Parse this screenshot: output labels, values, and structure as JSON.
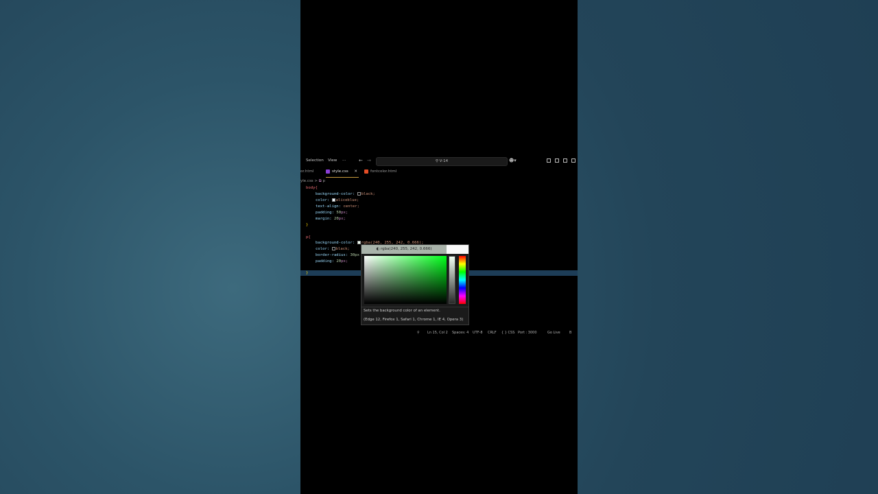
{
  "menu": {
    "selection": "Selection",
    "view": "View",
    "more": "···"
  },
  "search": {
    "text": "V-14"
  },
  "icons": {
    "back": "arrow-left-icon",
    "forward": "arrow-right-icon",
    "search": "search-icon",
    "copilot": "copilot-icon",
    "layouts": [
      "layout-icon",
      "sidebar-left-icon",
      "panel-icon",
      "sidebar-right-icon"
    ]
  },
  "tabs": [
    {
      "label": "or.html",
      "type": "html"
    },
    {
      "label": "style.css",
      "type": "css",
      "active": true,
      "close": "✕"
    },
    {
      "label": "fontcolor.html",
      "type": "html"
    }
  ],
  "breadcrumb": {
    "file": "yle.css",
    "sep": ">",
    "symbol": "p"
  },
  "code": {
    "body_selector": "body{",
    "body_lines": [
      {
        "prop": "background-color:",
        "swatch": "#000000",
        "value": "black;"
      },
      {
        "prop": "color:",
        "swatch": "#f0f8ff",
        "value": "aliceblue;"
      },
      {
        "prop": "text-align:",
        "value": "center;"
      },
      {
        "prop": "padding:",
        "num": "50",
        "unit": "px;"
      },
      {
        "prop": "margin:",
        "num": "20",
        "unit": "px;"
      }
    ],
    "close_brace": "}",
    "p_selector": "p{",
    "p_bg_prop": "background-color:",
    "p_bg_value": "rgba(240, 255, 242, 0.666);",
    "p_color_prop": "color:",
    "p_color_value": "black;",
    "p_radius_prop": "border-radius:",
    "p_radius_value": "30px",
    "p_padding_prop": "padding:",
    "p_padding_num": "20",
    "p_padding_unit": "px;"
  },
  "picker": {
    "header": "rgba(240, 255, 242, 0.666)",
    "current_color": "rgba(240,255,242,0.666)",
    "description": "Sets the background color of an element.",
    "compat": "(Edge 12, Firefox 1, Safari 1, Chrome 1, IE 4, Opera 3)"
  },
  "statusbar": {
    "position": "Ln 15, Col 2",
    "spaces": "Spaces: 4",
    "encoding": "UTF-8",
    "eol": "CRLF",
    "language": "{ } CSS",
    "port": "Port : 3000",
    "golive": "Go Live",
    "extra": "B"
  }
}
